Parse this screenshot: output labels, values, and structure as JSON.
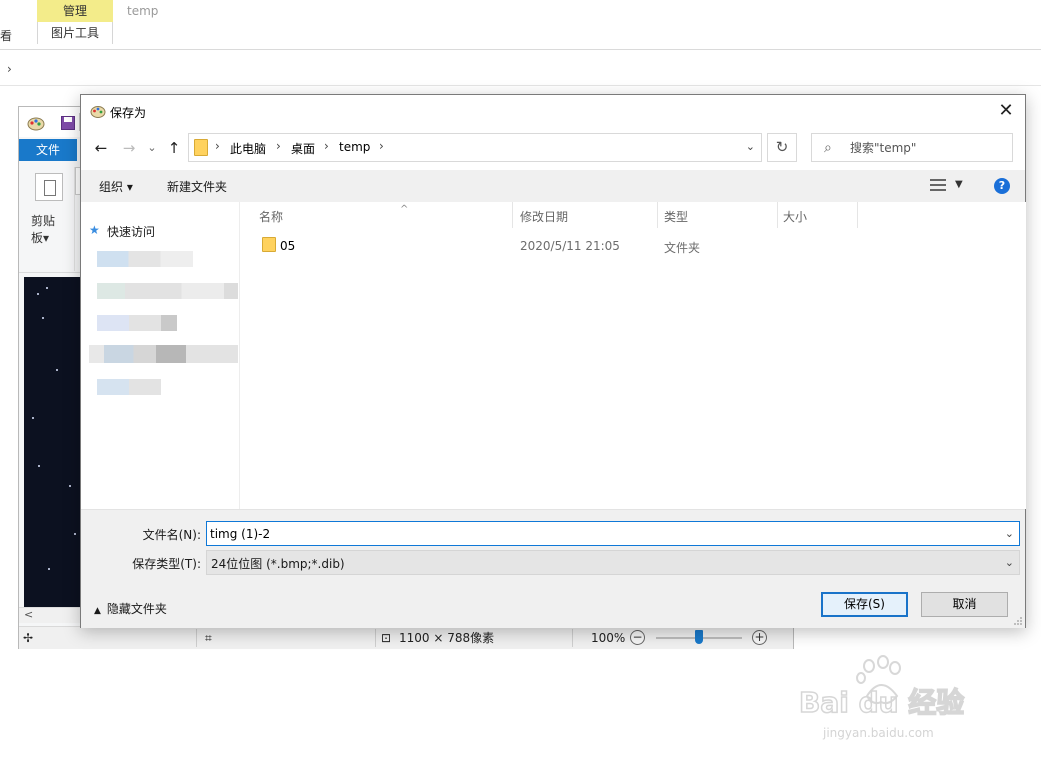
{
  "explorer": {
    "context_group": "管理",
    "context_tab": "图片工具",
    "title": "temp",
    "view_tab": "查看",
    "address_arrow": "›"
  },
  "paint": {
    "file_tab": "文件",
    "clipboard_label": "剪贴\n板▾",
    "status_pixels": "1100 × 788像素",
    "zoom": "100%"
  },
  "dialog": {
    "title": "保存为",
    "close_glyph": "✕",
    "nav": {
      "back": "←",
      "forward": "→",
      "recent": "⌄",
      "up": "↑"
    },
    "breadcrumbs": [
      "此电脑",
      "桌面",
      "temp"
    ],
    "refresh_glyph": "↻",
    "search_placeholder": "搜索\"temp\"",
    "toolbar": {
      "organize": "组织 ▾",
      "new_folder": "新建文件夹",
      "help": "?"
    },
    "nav_pane": {
      "quick_access": "快速访问"
    },
    "columns": [
      "名称",
      "修改日期",
      "类型",
      "大小"
    ],
    "files": [
      {
        "name": "05",
        "modified": "2020/5/11 21:05",
        "type": "文件夹",
        "size": ""
      }
    ],
    "filename_label": "文件名(N):",
    "filename_value": "timg (1)-2",
    "filetype_label": "保存类型(T):",
    "filetype_value": "24位位图 (*.bmp;*.dib)",
    "hide_folders": "隐藏文件夹",
    "save_button": "保存(S)",
    "cancel_button": "取消"
  },
  "watermark": {
    "brand": "Bai du 经验",
    "url": "jingyan.baidu.com"
  },
  "colors": {
    "accent": "#0f78d7",
    "folder": "#ffd25e",
    "paint_file_tab": "#1979ca",
    "context_group": "#f3ec8a"
  }
}
